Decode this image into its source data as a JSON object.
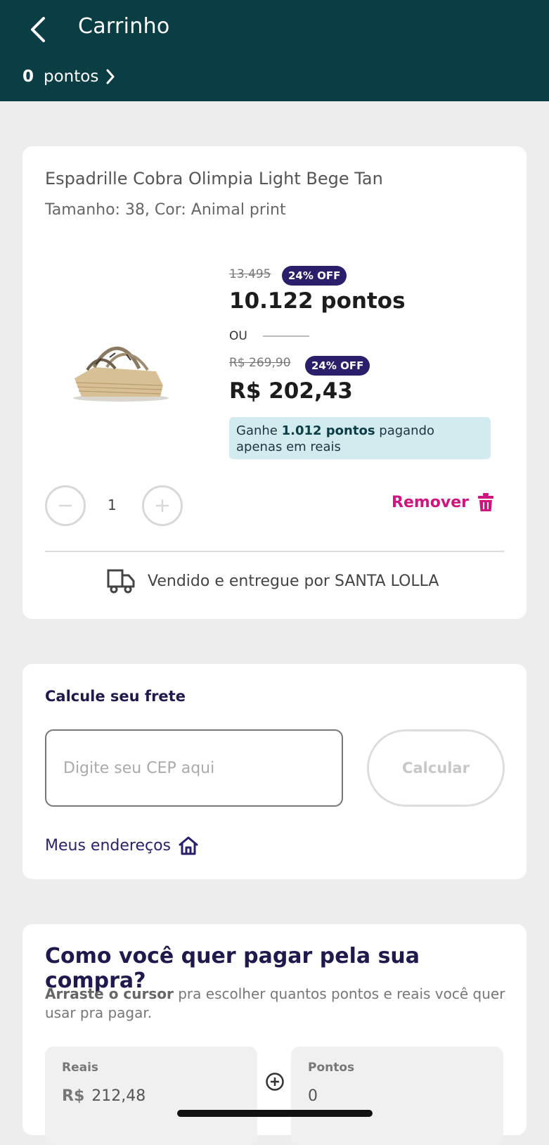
{
  "header": {
    "title": "Carrinho",
    "points_value": "0",
    "points_label": "pontos"
  },
  "product": {
    "name": "Espadrille Cobra Olimpia Light Bege Tan",
    "variant": "Tamanho: 38, Cor: Animal print",
    "old_points": "13.495",
    "points_discount": "24% OFF",
    "points_price": "10.122 pontos",
    "or_label": "OU",
    "old_price": "R$ 269,90",
    "price_discount": "24% OFF",
    "price": "R$ 202,43",
    "earn": {
      "prefix": "Ganhe ",
      "points": "1.012 pontos",
      "suffix": " pagando apenas em reais"
    },
    "quantity": "1",
    "remove_label": "Remover",
    "seller": "Vendido e entregue por SANTA LOLLA"
  },
  "shipping": {
    "title": "Calcule seu frete",
    "cep_placeholder": "Digite seu CEP aqui",
    "calculate_label": "Calcular",
    "my_addresses_label": "Meus endereços"
  },
  "payment": {
    "title": "Como você quer pagar pela sua compra?",
    "desc_bold": "Arraste o cursor",
    "desc_rest": "  pra escolher quantos pontos e reais você quer usar pra pagar.",
    "reais_label": "Reais",
    "reais_currency": "R$",
    "reais_value": "212,48",
    "pontos_label": "Pontos",
    "pontos_value": "0"
  },
  "colors": {
    "header_bg": "#0b3d45",
    "badge_bg": "#2b1f6b",
    "accent_pink": "#d0157f",
    "earn_box_bg": "#d2ebee"
  }
}
